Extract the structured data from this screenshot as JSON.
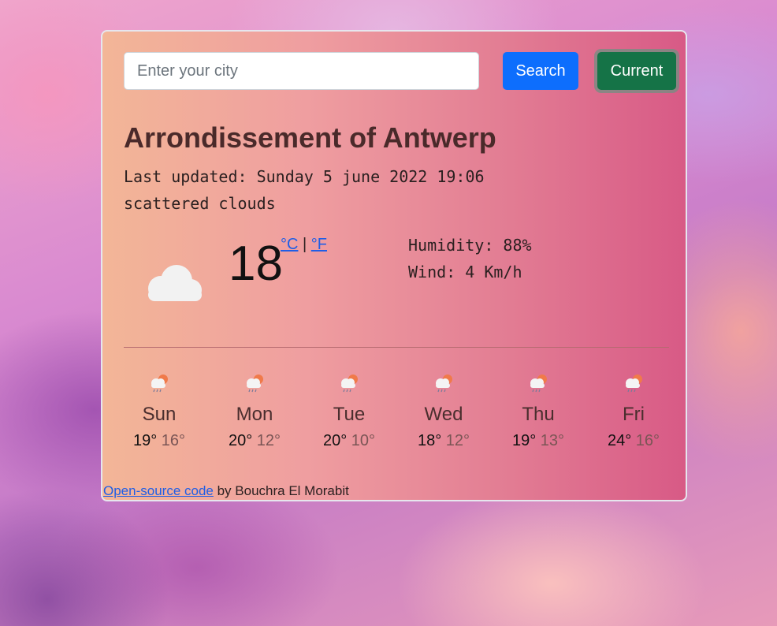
{
  "search": {
    "placeholder": "Enter your city",
    "search_label": "Search",
    "current_label": "Current"
  },
  "weather": {
    "city": "Arrondissement of Antwerp",
    "last_updated": "Last updated: Sunday 5 june 2022 19:06",
    "description": "scattered clouds",
    "icon": "cloud-icon",
    "temperature": "18",
    "unit_celsius": "°C",
    "unit_separator": "|",
    "unit_fahrenheit": "°F",
    "humidity": "Humidity: 88%",
    "wind": "Wind: 4 Km/h"
  },
  "forecast": [
    {
      "day": "Sun",
      "max": "19°",
      "min": "16°",
      "icon": "rain-cloud-sun-icon"
    },
    {
      "day": "Mon",
      "max": "20°",
      "min": "12°",
      "icon": "rain-cloud-sun-icon"
    },
    {
      "day": "Tue",
      "max": "20°",
      "min": "10°",
      "icon": "rain-cloud-sun-icon"
    },
    {
      "day": "Wed",
      "max": "18°",
      "min": "12°",
      "icon": "rain-cloud-sun-icon"
    },
    {
      "day": "Thu",
      "max": "19°",
      "min": "13°",
      "icon": "rain-cloud-sun-icon"
    },
    {
      "day": "Fri",
      "max": "24°",
      "min": "16°",
      "icon": "rain-cloud-sun-icon"
    }
  ],
  "footer": {
    "link_label": "Open-source code",
    "credit": " by Bouchra El Morabit"
  },
  "colors": {
    "search_button": "#0d6efd",
    "current_button": "#157347",
    "link": "#1f5ee6"
  }
}
